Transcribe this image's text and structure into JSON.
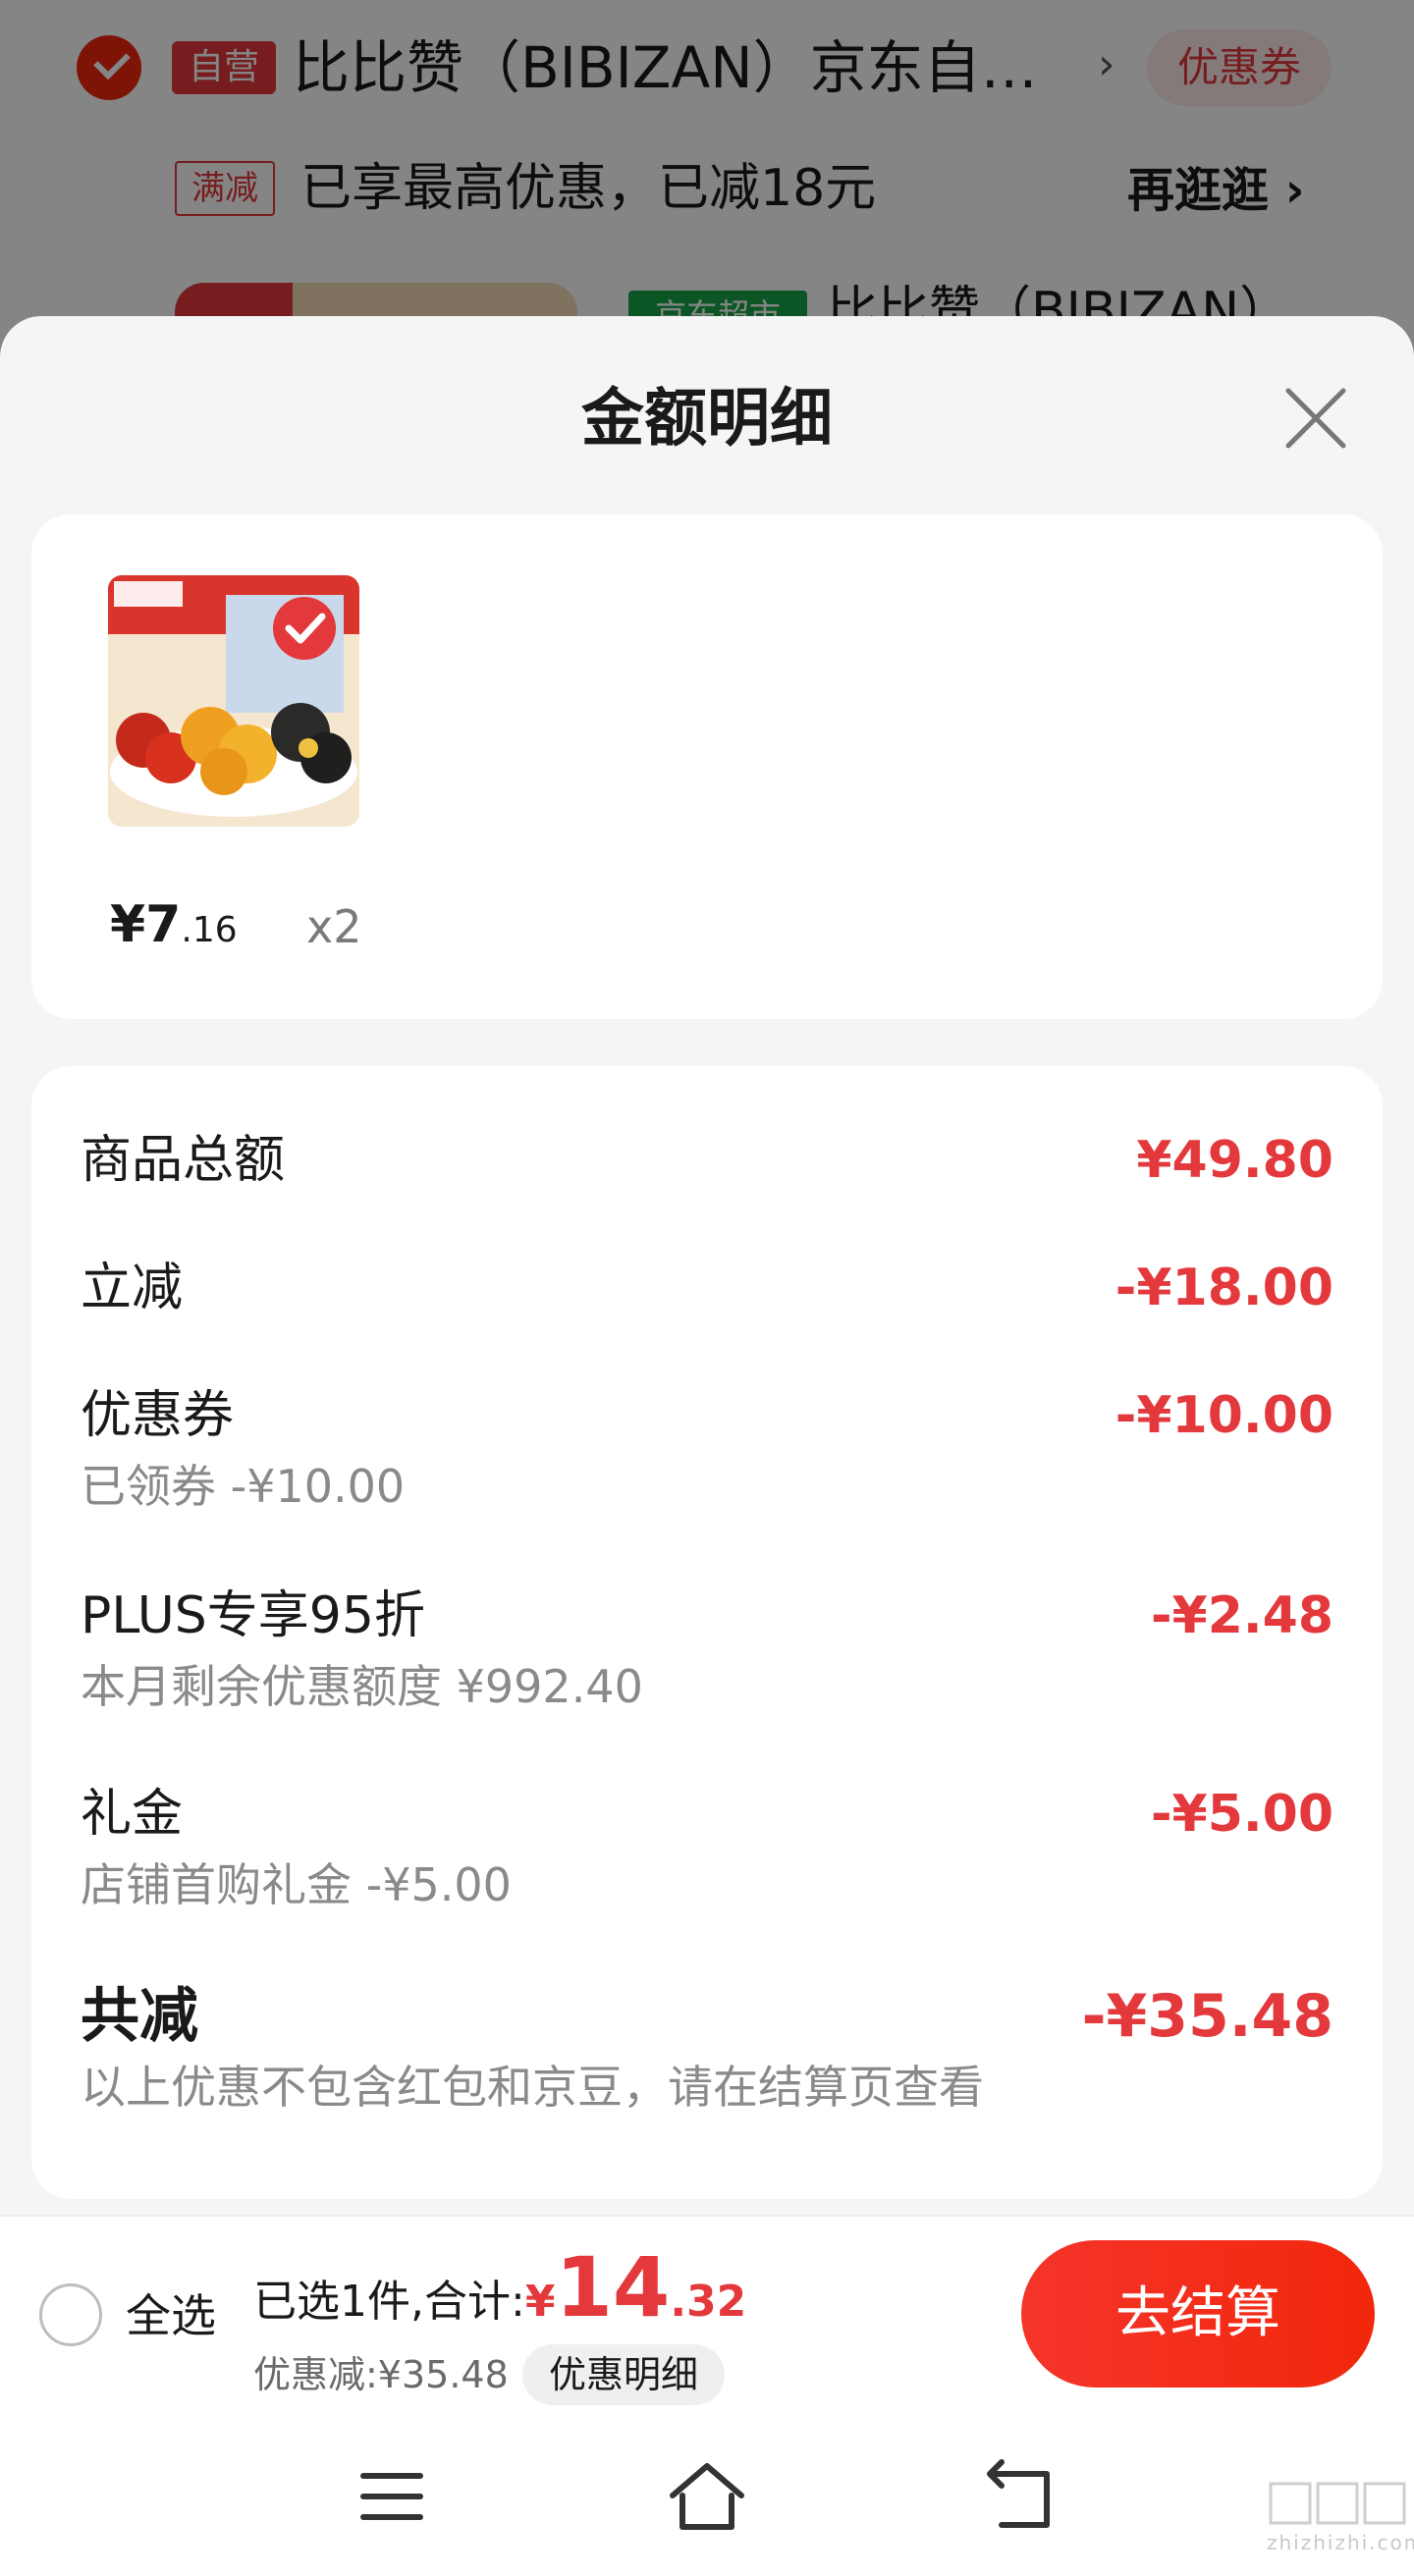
{
  "background_cart": {
    "self_tag": "自营",
    "store_name": "比比赞（BIBIZAN）京东自…",
    "chevron": "›",
    "coupon_button": "优惠券",
    "promo_tag": "满减",
    "promo_text": "已享最高优惠，已减18元",
    "shop_more": "再逛逛 ›",
    "jd_tag": "京东超市",
    "item_title": "比比赞（BIBIZAN）"
  },
  "sheet": {
    "title": "金额明细",
    "product": {
      "price_int": "¥7",
      "price_dec": ".16",
      "quantity": "x2"
    },
    "rows": [
      {
        "label": "商品总额",
        "value": "¥49.80",
        "sub": ""
      },
      {
        "label": "立减",
        "value": "-¥18.00",
        "sub": ""
      },
      {
        "label": "优惠券",
        "value": "-¥10.00",
        "sub": "已领券 -¥10.00"
      },
      {
        "label": "PLUS专享95折",
        "value": "-¥2.48",
        "sub": "本月剩余优惠额度 ¥992.40"
      },
      {
        "label": "礼金",
        "value": "-¥5.00",
        "sub": "店铺首购礼金 -¥5.00"
      },
      {
        "label": "共减",
        "value": "-¥35.48",
        "sub": "以上优惠不包含红包和京豆，请在结算页查看"
      }
    ]
  },
  "bottom_bar": {
    "select_all": "全选",
    "selected_prefix": "已选1件,合计:",
    "currency": "¥",
    "total_int": "14",
    "total_dec": ".32",
    "discount": "优惠减:¥35.48",
    "detail_chip": "优惠明细",
    "checkout": "去结算"
  },
  "watermark": "zhizhizhi.com",
  "colors": {
    "accent": "#e4393c",
    "checkout": "#f2270c",
    "jd_green": "#18a648"
  }
}
